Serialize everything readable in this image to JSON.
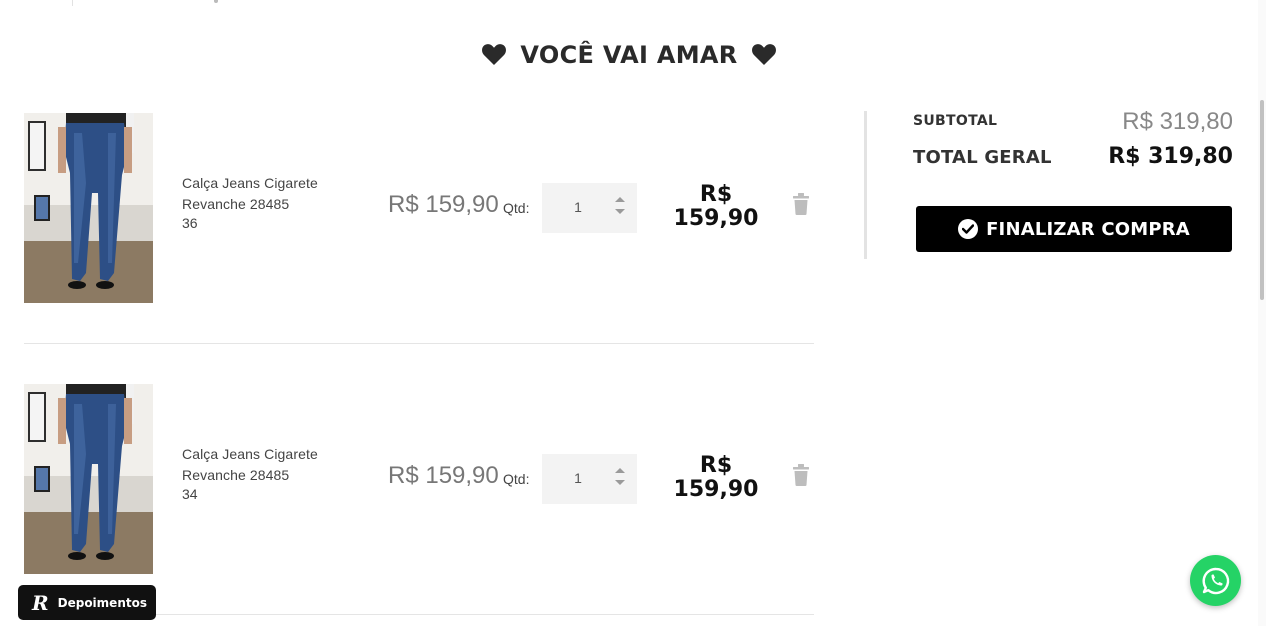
{
  "section": {
    "title": "VOCÊ VAI AMAR"
  },
  "cart": {
    "qty_label": "Qtd:",
    "items": [
      {
        "name": "Calça Jeans Cigarete Revanche 28485",
        "size": "36",
        "unit_price": "R$ 159,90",
        "quantity": "1",
        "total_price": "R$ 159,90",
        "image_icon": "jeans-product-photo"
      },
      {
        "name": "Calça Jeans Cigarete Revanche 28485",
        "size": "34",
        "unit_price": "R$ 159,90",
        "quantity": "1",
        "total_price": "R$ 159,90",
        "image_icon": "jeans-product-photo"
      }
    ]
  },
  "summary": {
    "subtotal_label": "SUBTOTAL",
    "subtotal_value": "R$ 319,80",
    "grand_total_label": "TOTAL GERAL",
    "grand_total_value": "R$ 319,80",
    "checkout_label": "FINALIZAR COMPRA"
  },
  "floating": {
    "testimonials_label": "Depoimentos",
    "testimonials_logo": "R",
    "whatsapp_icon": "whatsapp-icon"
  },
  "colors": {
    "accent": "#000000",
    "whatsapp": "#25d366",
    "price_muted": "#777777"
  }
}
